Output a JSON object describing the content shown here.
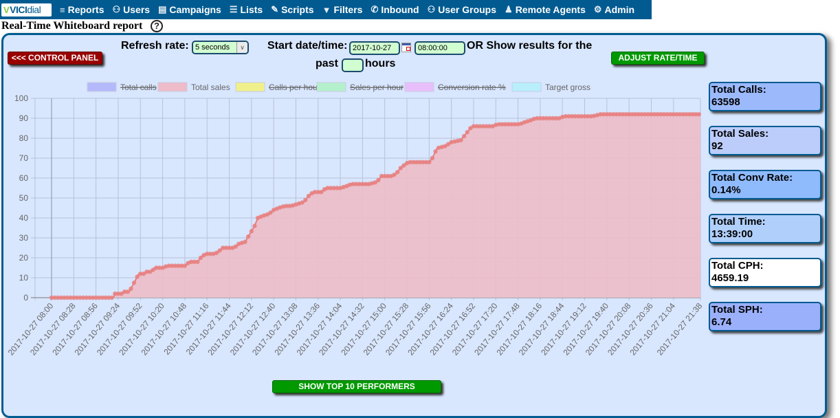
{
  "nav": {
    "logo": {
      "v": "V",
      "vici": "VICI",
      "dial": "dial"
    },
    "items": [
      {
        "label": "Reports",
        "icon": "bar-chart-icon",
        "glyph": "≡"
      },
      {
        "label": "Users",
        "icon": "users-icon",
        "glyph": "⚇"
      },
      {
        "label": "Campaigns",
        "icon": "campaigns-icon",
        "glyph": "▤"
      },
      {
        "label": "Lists",
        "icon": "lists-icon",
        "glyph": "☰"
      },
      {
        "label": "Scripts",
        "icon": "scripts-icon",
        "glyph": "✎"
      },
      {
        "label": "Filters",
        "icon": "filter-icon",
        "glyph": "▼"
      },
      {
        "label": "Inbound",
        "icon": "phone-icon",
        "glyph": "✆"
      },
      {
        "label": "User Groups",
        "icon": "user-groups-icon",
        "glyph": "⚇"
      },
      {
        "label": "Remote Agents",
        "icon": "remote-agents-icon",
        "glyph": "♟"
      },
      {
        "label": "Admin",
        "icon": "gear-icon",
        "glyph": "⚙"
      }
    ]
  },
  "page": {
    "title": "Real-Time Whiteboard report",
    "help": "?"
  },
  "controls": {
    "control_panel_label": "<<< CONTROL PANEL",
    "refresh_label": "Refresh rate:",
    "refresh_value": "5 seconds",
    "start_label": "Start date/time:",
    "start_date": "2017-10-27",
    "start_time": "08:00:00",
    "or_label": "OR Show results for the",
    "past_label": "past",
    "past_hours_value": "",
    "hours_label": "hours",
    "adjust_label": "ADJUST RATE/TIME",
    "top10_label": "SHOW TOP 10 PERFORMERS"
  },
  "stats": [
    {
      "label": "Total Calls:",
      "value": "63598",
      "color": "#9BB9FB"
    },
    {
      "label": "Total Sales:",
      "value": "92",
      "color": "#BCCDFB"
    },
    {
      "label": "Total Conv Rate:",
      "value": "0.14%",
      "color": "#8FBAFB"
    },
    {
      "label": "Total Time:",
      "value": "13:39:00",
      "color": "#B1CFFB"
    },
    {
      "label": "Total CPH:",
      "value": "4659.19",
      "color": "#FFFFFF"
    },
    {
      "label": "Total SPH:",
      "value": "6.74",
      "color": "#9BB0FB"
    }
  ],
  "chart_data": {
    "type": "area",
    "title": "",
    "xlabel": "",
    "ylabel": "",
    "ylim": [
      0,
      100
    ],
    "yticks": [
      0,
      10,
      20,
      30,
      40,
      50,
      60,
      70,
      80,
      90,
      100
    ],
    "grid": true,
    "legend_position": "top-center",
    "legend": [
      {
        "name": "Total calls",
        "color": "#B4B9FB",
        "hidden": true
      },
      {
        "name": "Total sales",
        "color": "#EDBCC8",
        "hidden": false
      },
      {
        "name": "Calls per hour",
        "color": "#F0F08A",
        "hidden": true
      },
      {
        "name": "Sales per hour",
        "color": "#B4F0CC",
        "hidden": true
      },
      {
        "name": "Conversion rate %",
        "color": "#E8BEFB",
        "hidden": true
      },
      {
        "name": "Target gross",
        "color": "#B9EEFB",
        "hidden": false
      }
    ],
    "x_tick_labels": [
      "2017-10-27 08:00",
      "2017-10-27 08:28",
      "2017-10-27 08:56",
      "2017-10-27 09:24",
      "2017-10-27 09:52",
      "2017-10-27 10:20",
      "2017-10-27 10:48",
      "2017-10-27 11:16",
      "2017-10-27 11:44",
      "2017-10-27 12:12",
      "2017-10-27 12:40",
      "2017-10-27 13:08",
      "2017-10-27 13:36",
      "2017-10-27 14:04",
      "2017-10-27 14:32",
      "2017-10-27 15:00",
      "2017-10-27 15:28",
      "2017-10-27 15:56",
      "2017-10-27 16:24",
      "2017-10-27 16:52",
      "2017-10-27 17:20",
      "2017-10-27 17:48",
      "2017-10-27 18:16",
      "2017-10-27 18:44",
      "2017-10-27 19:12",
      "2017-10-27 19:40",
      "2017-10-27 20:08",
      "2017-10-27 20:36",
      "2017-10-27 21:04",
      "2017-10-27 21:38"
    ],
    "x_range_minutes": [
      0,
      818
    ],
    "series": [
      {
        "name": "Total sales",
        "line_color": "#E88080",
        "fill_color": "#EDBCC8",
        "points_minutes_value": [
          [
            0,
            0
          ],
          [
            60,
            0
          ],
          [
            78,
            0
          ],
          [
            80,
            2
          ],
          [
            88,
            2
          ],
          [
            92,
            3
          ],
          [
            98,
            3
          ],
          [
            102,
            6
          ],
          [
            106,
            9
          ],
          [
            110,
            12
          ],
          [
            116,
            12
          ],
          [
            120,
            13
          ],
          [
            126,
            13
          ],
          [
            130,
            15
          ],
          [
            140,
            15
          ],
          [
            146,
            16
          ],
          [
            168,
            16
          ],
          [
            174,
            18
          ],
          [
            184,
            18
          ],
          [
            190,
            21
          ],
          [
            196,
            22
          ],
          [
            206,
            22
          ],
          [
            210,
            23
          ],
          [
            216,
            25
          ],
          [
            230,
            25
          ],
          [
            236,
            27
          ],
          [
            244,
            28
          ],
          [
            250,
            32
          ],
          [
            256,
            36
          ],
          [
            260,
            40
          ],
          [
            266,
            41
          ],
          [
            274,
            42
          ],
          [
            280,
            44
          ],
          [
            286,
            45
          ],
          [
            294,
            46
          ],
          [
            302,
            46
          ],
          [
            310,
            47
          ],
          [
            318,
            48
          ],
          [
            324,
            51
          ],
          [
            330,
            53
          ],
          [
            340,
            53
          ],
          [
            346,
            55
          ],
          [
            364,
            55
          ],
          [
            372,
            56
          ],
          [
            378,
            57
          ],
          [
            400,
            57
          ],
          [
            410,
            58
          ],
          [
            416,
            61
          ],
          [
            430,
            61
          ],
          [
            436,
            63
          ],
          [
            440,
            65
          ],
          [
            446,
            67
          ],
          [
            450,
            68
          ],
          [
            476,
            68
          ],
          [
            480,
            70
          ],
          [
            486,
            75
          ],
          [
            496,
            76
          ],
          [
            504,
            78
          ],
          [
            516,
            79
          ],
          [
            520,
            81
          ],
          [
            524,
            83
          ],
          [
            528,
            85
          ],
          [
            532,
            86
          ],
          [
            556,
            86
          ],
          [
            562,
            87
          ],
          [
            590,
            87
          ],
          [
            596,
            88
          ],
          [
            604,
            89
          ],
          [
            610,
            90
          ],
          [
            640,
            90
          ],
          [
            646,
            91
          ],
          [
            682,
            91
          ],
          [
            692,
            92
          ],
          [
            818,
            92
          ]
        ]
      }
    ]
  }
}
